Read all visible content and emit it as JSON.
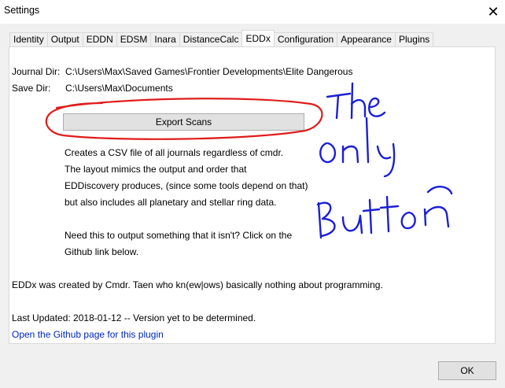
{
  "window": {
    "title": "Settings",
    "close_glyph": "✕"
  },
  "tabs": [
    {
      "label": "Identity"
    },
    {
      "label": "Output"
    },
    {
      "label": "EDDN"
    },
    {
      "label": "EDSM"
    },
    {
      "label": "Inara"
    },
    {
      "label": "DistanceCalc"
    },
    {
      "label": "EDDx",
      "active": true
    },
    {
      "label": "Configuration"
    },
    {
      "label": "Appearance"
    },
    {
      "label": "Plugins"
    }
  ],
  "eddx": {
    "journal_label": "Journal Dir:",
    "journal_value": "C:\\Users\\Max\\Saved Games\\Frontier Developments\\Elite Dangerous",
    "save_label": "Save Dir:",
    "save_value": "C:\\Users\\Max\\Documents",
    "export_button": "Export Scans",
    "description": [
      "Creates a CSV file of all journals regardless of cmdr.",
      "The layout mimics the output and order that",
      "EDDiscovery produces, (since some tools depend on that)",
      "but also includes all planetary and stellar ring data.",
      "Need this to output something that it isn't? Click on the",
      "Github link below."
    ],
    "created_by": "EDDx was created by Cmdr. Taen who kn(ew|ows) basically nothing about programming.",
    "last_updated": "Last Updated: 2018-01-12 -- Version yet to be determined.",
    "github_link": "Open the Github page for this plugin"
  },
  "annotation": {
    "handwritten_text": "The Only Button",
    "ink_color": "#1b1fd6",
    "circle_color": "#e01b1b"
  },
  "footer": {
    "ok_button": "OK"
  }
}
